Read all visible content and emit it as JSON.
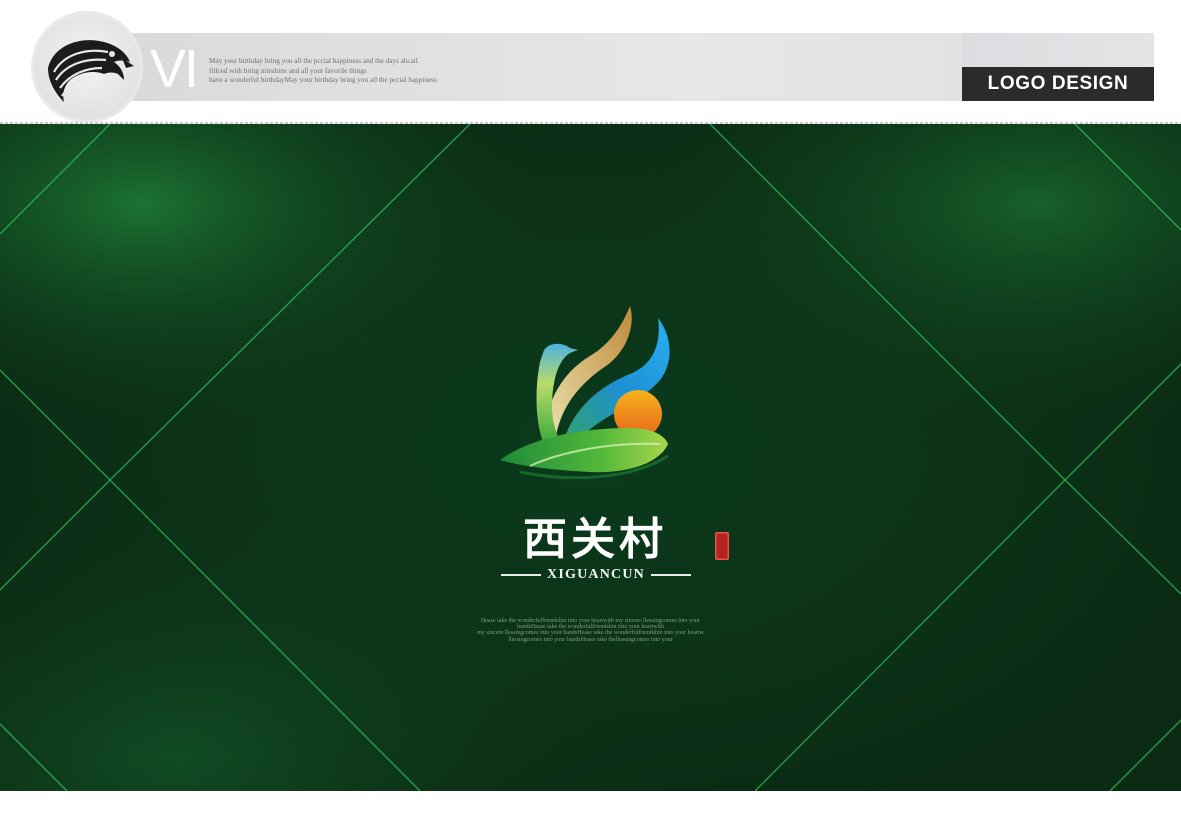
{
  "header": {
    "vi_mark": "VI",
    "tagline_lines": [
      "May your birthday bring you all the pccial happiness and  the days ahcail",
      "fillced with bring  minshine and all your favorile things",
      "have a wonderful birthdayMay your birthday bring you all the pccial happiness"
    ],
    "logo_design_label": "LOGO DESIGN",
    "emblem_icon": "eagle-head-icon"
  },
  "showcase": {
    "brand_name_cn": "西关村",
    "brand_name_en": "XIGUANCUN",
    "logo_icon": "bird-sun-leaf-logo-icon",
    "seal_icon": "red-seal-stamp-icon",
    "blessing_lines": [
      "Hease take the wonderfulfriendshin into your heartwith my sincere llessingcomes into your",
      "handsHease take the wonderfulfriendshin into your heartwith",
      "my sincere llessingcomes into your handsHease take the wonderfulfriendshin into your heartw",
      "llessingcomes into your handsHease take thellessingcomes into your"
    ]
  },
  "colors": {
    "panel_green": "#0c3318",
    "grid_line_green": "#2fbf55",
    "header_gray": "#e3e4e6",
    "label_dark": "#2b2b2b",
    "logo_blue": "#1e8fd6",
    "logo_gold": "#c8a04a",
    "logo_green": "#3aa83a",
    "logo_sun": "#f08a1a",
    "seal_red": "#b4231c"
  }
}
